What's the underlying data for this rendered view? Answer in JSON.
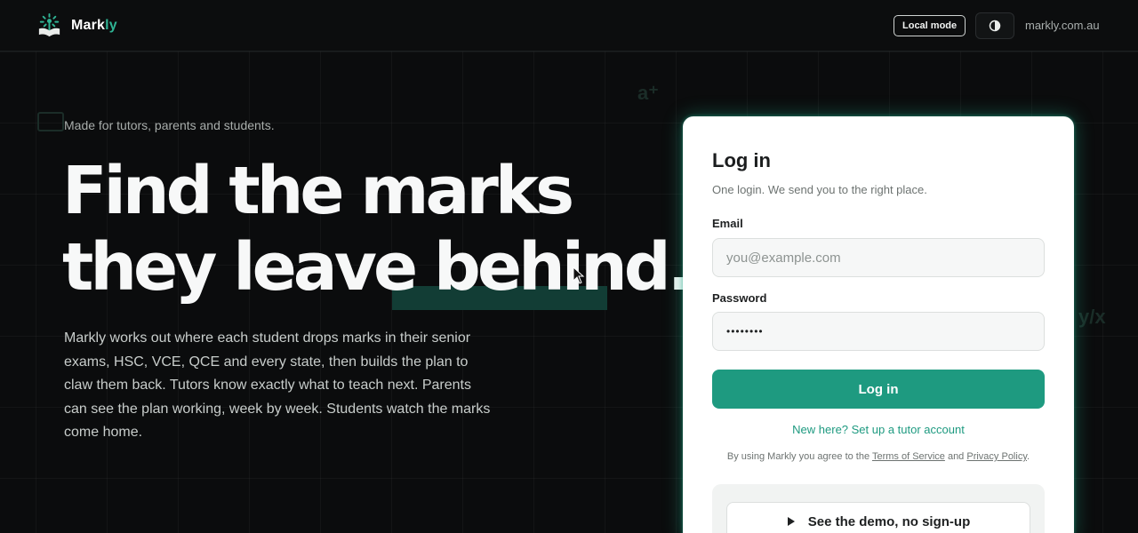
{
  "brand": {
    "name_main": "Mark",
    "name_accent": "ly",
    "logo_icon": "tree-book-icon"
  },
  "header": {
    "mode_badge": "Local mode",
    "theme_icon": "contrast-icon",
    "site_link": "markly.com.au"
  },
  "hero": {
    "tagline": "Made for tutors, parents and students.",
    "title_line1": "Find the marks",
    "title_line2_a": "they leave ",
    "title_line2_b": "behind",
    "title_line2_c": ".",
    "body": "Markly works out where each student drops marks in their senior exams, HSC, VCE, QCE and every state, then builds the plan to claw them back. Tutors know exactly what to teach next. Parents can see the plan working, week by week. Students watch the marks come home."
  },
  "login": {
    "title": "Log in",
    "subtitle": "One login. We send you to the right place.",
    "email_label": "Email",
    "email_placeholder": "you@example.com",
    "password_label": "Password",
    "password_value": "••••••••",
    "submit_label": "Log in",
    "signup_link": "New here? Set up a tutor account",
    "terms_prefix": "By using Markly you agree to the ",
    "terms_link": "Terms of Service",
    "terms_and": " and ",
    "privacy_link": "Privacy Policy",
    "terms_suffix": ".",
    "demo_label": "See the demo, no sign-up",
    "demo_icon": "play-icon"
  },
  "colors": {
    "accent": "#1e9a80",
    "background": "#0b0c0d",
    "highlight": "#123d35"
  }
}
